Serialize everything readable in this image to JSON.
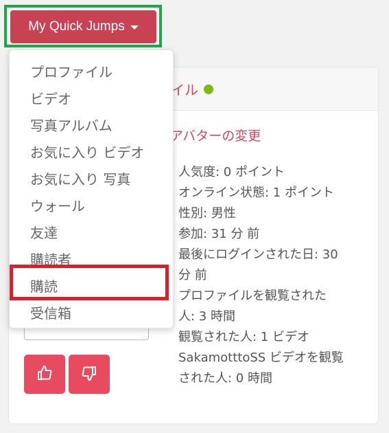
{
  "quick_jumps": {
    "label": "My Quick Jumps",
    "menu_items": [
      "プロファイル",
      "ビデオ",
      "写真アルバム",
      "お気に入り ビデオ",
      "お気に入り 写真",
      "ウォール",
      "友達",
      "購読者",
      "購読",
      "受信箱"
    ]
  },
  "profile": {
    "title_partial": "イル",
    "avatar_link": "アバターの変更",
    "stats": [
      "人気度: 0 ポイント",
      "オンライン状態: 1 ポイント",
      "性別: 男性",
      "参加: 31 分 前",
      "最後にログインされた日: 30",
      "分 前",
      "プロファイルを観覧された",
      "人: 3 時間",
      "観覧された人: 1 ビデオ",
      "SakamotttoSS ビデオを観覧",
      "された人: 0 時間"
    ]
  },
  "colors": {
    "button_bg": "#c94254",
    "vote_bg": "#e84a5f",
    "online": "#7cbb12",
    "highlight_green": "#1ea64a",
    "highlight_red": "#d9202b"
  },
  "icons": {
    "like": "thumbs-up-icon",
    "dislike": "thumbs-down-icon"
  }
}
